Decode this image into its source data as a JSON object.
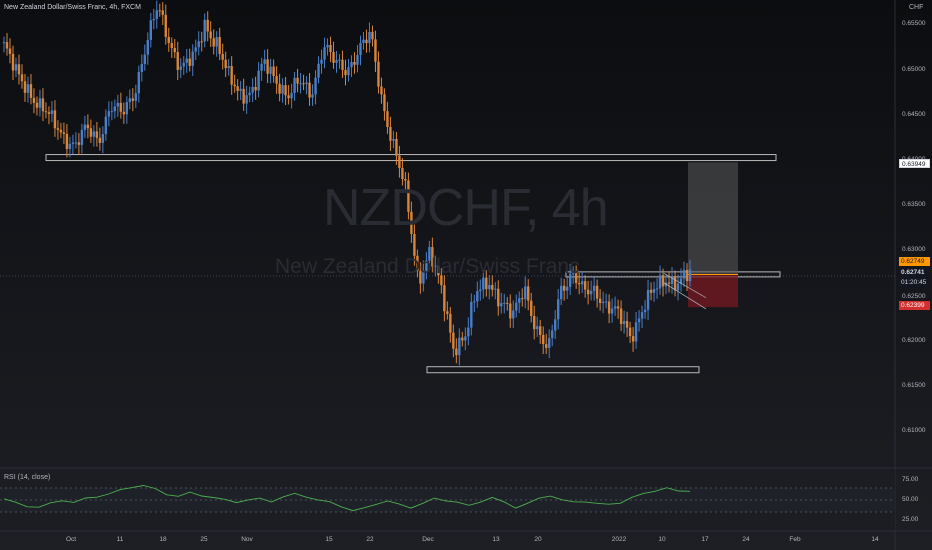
{
  "header": {
    "title": "New Zealand Dollar/Swiss Franc, 4h, FXCM",
    "currency": "CHF"
  },
  "watermark": {
    "symbol": "NZDCHF, 4h",
    "name": "New Zealand Dollar/Swiss Franc"
  },
  "price_axis": {
    "ticks": [
      "0.65500",
      "0.65000",
      "0.64500",
      "0.64000",
      "0.63500",
      "0.63000",
      "0.62500",
      "0.62000",
      "0.61500",
      "0.61000"
    ]
  },
  "tags": {
    "level_white": "0.63949",
    "target": "0.62749",
    "last": "0.62741",
    "countdown": "01:20:45",
    "stop": "0.62399"
  },
  "rsi": {
    "label": "RSI (14, close)",
    "ticks": [
      "75.00",
      "50.00",
      "25.00"
    ]
  },
  "time_axis": {
    "labels": [
      "Oct",
      "11",
      "18",
      "25",
      "Nov",
      "15",
      "22",
      "Dec",
      "13",
      "20",
      "2022",
      "10",
      "17",
      "24",
      "Feb",
      "14"
    ]
  },
  "colors": {
    "bull": "#4a7fc8",
    "bear": "#d9863a",
    "rsi": "#4caf50",
    "zone": "#9e9e9e"
  },
  "chart_data": {
    "type": "candlestick",
    "title": "New Zealand Dollar/Swiss Franc, 4h, FXCM",
    "y_range": [
      0.607,
      0.656
    ],
    "horizontal_levels": [
      0.64,
      0.6275,
      0.6173
    ],
    "position": {
      "entry": 0.62749,
      "target": 0.63949,
      "stop": 0.62399
    },
    "price_path": [
      [
        "Oct",
        0.652
      ],
      [
        "",
        0.649
      ],
      [
        "",
        0.6475
      ],
      [
        "",
        0.6455
      ],
      [
        "",
        0.644
      ],
      [
        "",
        0.6425
      ],
      [
        "",
        0.6412
      ],
      [
        "11",
        0.643
      ],
      [
        "",
        0.642
      ],
      [
        "",
        0.6455
      ],
      [
        "",
        0.6445
      ],
      [
        "",
        0.647
      ],
      [
        "",
        0.652
      ],
      [
        "18",
        0.656
      ],
      [
        "",
        0.6525
      ],
      [
        "",
        0.6495
      ],
      [
        "",
        0.6505
      ],
      [
        "25",
        0.6545
      ],
      [
        "",
        0.652
      ],
      [
        "",
        0.6485
      ],
      [
        "",
        0.647
      ],
      [
        "Nov",
        0.647
      ],
      [
        "",
        0.65
      ],
      [
        "",
        0.6485
      ],
      [
        "",
        0.6465
      ],
      [
        "",
        0.648
      ],
      [
        "",
        0.647
      ],
      [
        "15",
        0.652
      ],
      [
        "",
        0.65
      ],
      [
        "",
        0.6495
      ],
      [
        "",
        0.6515
      ],
      [
        "22",
        0.653
      ],
      [
        "",
        0.646
      ],
      [
        "",
        0.641
      ],
      [
        "",
        0.636
      ],
      [
        "Dec",
        0.627
      ],
      [
        "",
        0.63
      ],
      [
        "",
        0.6255
      ],
      [
        "",
        0.6198
      ],
      [
        "",
        0.621
      ],
      [
        "",
        0.6255
      ],
      [
        "",
        0.627
      ],
      [
        "13",
        0.6245
      ],
      [
        "",
        0.6228
      ],
      [
        "",
        0.6265
      ],
      [
        "",
        0.6215
      ],
      [
        "20",
        0.619
      ],
      [
        "",
        0.626
      ],
      [
        "",
        0.6275
      ],
      [
        "",
        0.6255
      ],
      [
        "2022",
        0.626
      ],
      [
        "",
        0.624
      ],
      [
        "",
        0.623
      ],
      [
        "",
        0.621
      ],
      [
        "",
        0.6238
      ],
      [
        "",
        0.6258
      ],
      [
        "10",
        0.6272
      ],
      [
        "",
        0.6266
      ],
      [
        "",
        0.6274
      ]
    ],
    "rsi": {
      "label": "RSI (14, close)",
      "levels": [
        70,
        50,
        30
      ],
      "values": [
        52,
        45,
        40,
        38,
        44,
        50,
        46,
        52,
        56,
        60,
        66,
        72,
        74,
        68,
        60,
        56,
        62,
        58,
        54,
        50,
        47,
        50,
        52,
        48,
        55,
        60,
        56,
        50,
        46,
        40,
        32,
        36,
        44,
        48,
        42,
        38,
        44,
        52,
        50,
        46,
        40,
        48,
        54,
        46,
        38,
        44,
        52,
        58,
        50,
        46,
        48,
        44,
        42,
        46,
        54,
        60,
        66,
        70,
        64,
        66
      ]
    }
  }
}
